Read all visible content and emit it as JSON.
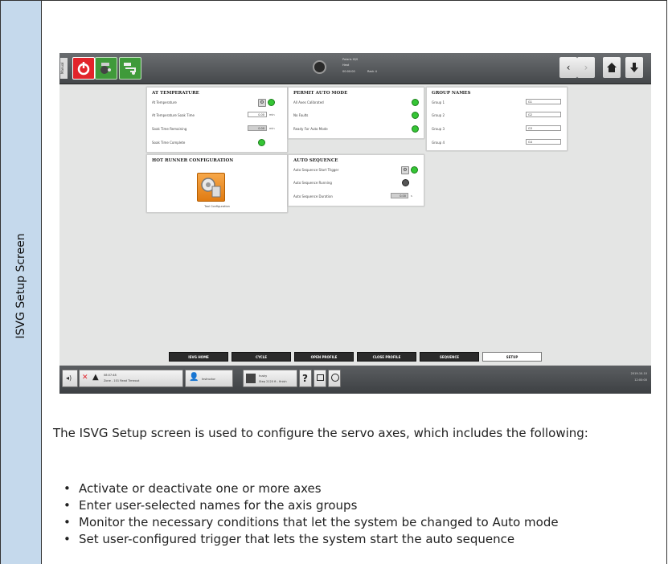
{
  "side_label": "ISVG Setup Screen",
  "topbar": {
    "manual_label": "Manual",
    "status_lines": [
      "Polaris IS/S",
      "Heat",
      "00:00:00",
      "Rack 4"
    ]
  },
  "cards": {
    "at_temperature": {
      "title": "AT TEMPERATURE",
      "rows": [
        "At Temperature",
        "At Temperature Soak Time",
        "Soak Time Remaining",
        "Soak Time Complete"
      ],
      "soak_time_value": "0.00",
      "soak_time_unit": "min",
      "soak_remaining_value": "0.00",
      "soak_remaining_unit": "min"
    },
    "permit_auto_mode": {
      "title": "PERMIT AUTO MODE",
      "rows": [
        "All Axes Calibrated",
        "No Faults",
        "Ready For Auto Mode"
      ]
    },
    "group_names": {
      "title": "GROUP NAMES",
      "rows": [
        {
          "label": "Group 1",
          "value": "G1"
        },
        {
          "label": "Group 2",
          "value": "G2"
        },
        {
          "label": "Group 3",
          "value": "G3"
        },
        {
          "label": "Group 4",
          "value": "G4"
        }
      ]
    },
    "hot_runner": {
      "title": "HOT RUNNER CONFIGURATION",
      "tool_label": "Tool Configuration"
    },
    "auto_sequence": {
      "title": "AUTO SEQUENCE",
      "rows": [
        "Auto Sequence Start Trigger",
        "Auto Sequence Running",
        "Auto Sequence Duration"
      ],
      "duration_value": "0.00",
      "duration_unit": "s"
    }
  },
  "tabs": [
    {
      "label": "ISVG HOME",
      "active": false
    },
    {
      "label": "CYCLE",
      "active": false
    },
    {
      "label": "OPEN PROFILE",
      "active": false
    },
    {
      "label": "CLOSE PROFILE",
      "active": false
    },
    {
      "label": "SEQUENCE",
      "active": false
    },
    {
      "label": "SETUP",
      "active": true
    }
  ],
  "bottombar": {
    "alarm_time": "08:07:48",
    "alarm_text": "Zone - 101 Read Timeout",
    "user_label": "Instructor",
    "mold_label": "husky",
    "mold_sub": "Step 2120 ft - finish",
    "date": "2019-10-10",
    "time": "12:00:00"
  },
  "description": "The ISVG Setup screen is used to configure the servo axes, which includes the following:",
  "bullets": [
    "Activate or deactivate one or more axes",
    "Enter user-selected names for the axis groups",
    "Monitor the necessary conditions that let the system be changed to Auto mode",
    "Set user-configured trigger that lets the system start the auto sequence"
  ],
  "colors": {
    "led_green": "#35c535",
    "alarm_red": "#e2242b",
    "sidebar_blue": "#c5d9ec"
  }
}
